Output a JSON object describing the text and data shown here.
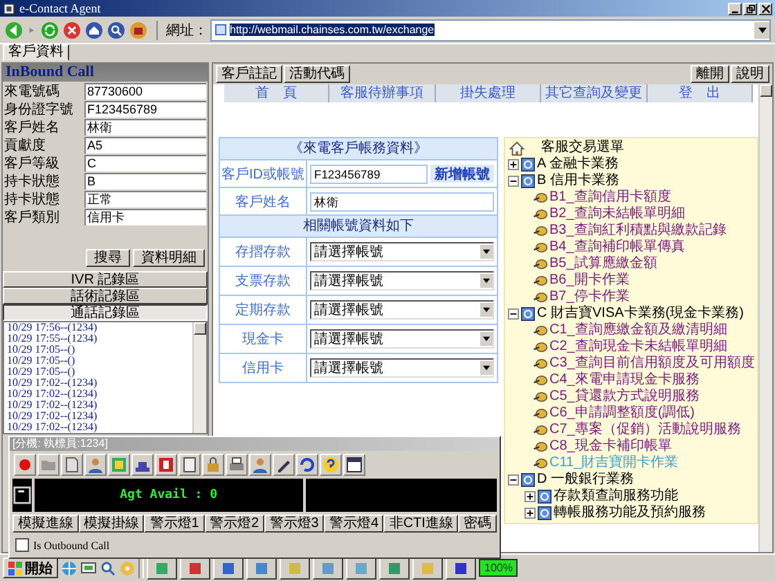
{
  "window": {
    "title": "e-Contact Agent"
  },
  "toolbar": {
    "address_label": "網址：",
    "url": "http://webmail.chainses.com.tw/exchange"
  },
  "main_tabs": [
    {
      "label": "客戶資料",
      "selected": true
    }
  ],
  "inbound": {
    "title": "InBound Call",
    "fields": [
      {
        "label": "來電號碼",
        "value": "87730600"
      },
      {
        "label": "身份證字號",
        "value": "F123456789"
      },
      {
        "label": "客戶姓名",
        "value": "林衛"
      },
      {
        "label": "貢獻度",
        "value": "A5"
      },
      {
        "label": "客戶等級",
        "value": "C"
      },
      {
        "label": "持卡狀態",
        "value": "B"
      },
      {
        "label": "持卡狀態",
        "value": "正常"
      },
      {
        "label": "客戶類別",
        "value": "信用卡"
      }
    ],
    "buttons": [
      "搜尋",
      "資料明細"
    ]
  },
  "record_sections": [
    {
      "label": "IVR 記錄區",
      "selected": false
    },
    {
      "label": "話術記錄區",
      "selected": false
    },
    {
      "label": "通話記錄區",
      "selected": true
    }
  ],
  "call_log": [
    "10/29 17:56--(1234)",
    "10/29 17:55--(1234)",
    "10/29 17:05--()",
    "10/29 17:05--()",
    "10/29 17:05--()",
    "10/29 17:02--(1234)",
    "10/29 17:02--(1234)",
    "10/29 17:02--(1234)",
    "10/29 17:02--(1234)",
    "10/29 17:02--(1234)"
  ],
  "phone_bar": {
    "title": "[分機: 執標員:1234]",
    "display": "Agt Avail : 0",
    "buttons": [
      "模擬進線",
      "模擬掛線",
      "警示燈1",
      "警示燈2",
      "警示燈3",
      "警示燈4",
      "非CTI進線",
      "密碼"
    ],
    "outbound": {
      "label": "Is Outbound Call",
      "checked": false
    }
  },
  "content_tabs": [
    "客戶註記",
    "活動代碼"
  ],
  "window_buttons": [
    "離開",
    "說明"
  ],
  "nav": [
    "首　頁",
    "客服待辦事項",
    "掛失處理",
    "其它查詢及變更",
    "登　出"
  ],
  "account_form": {
    "title": "《來電客戶帳務資料》",
    "id_label": "客戶ID或帳號",
    "id_value": "F123456789",
    "add_button": "新增帳號",
    "name_label": "客戶姓名",
    "name_value": "林衛",
    "subtitle": "相關帳號資料如下",
    "accounts": [
      {
        "label": "存摺存款",
        "value": "請選擇帳號"
      },
      {
        "label": "支票存款",
        "value": "請選擇帳號"
      },
      {
        "label": "定期存款",
        "value": "請選擇帳號"
      },
      {
        "label": "現金卡",
        "value": "請選擇帳號"
      },
      {
        "label": "信用卡",
        "value": "請選擇帳號"
      }
    ]
  },
  "menu_tree": {
    "label": "客服交易選單",
    "children": [
      {
        "label": "A 金融卡業務",
        "expanded": false
      },
      {
        "label": "B 信用卡業務",
        "expanded": true,
        "children": [
          {
            "label": "B1_查詢信用卡額度",
            "selected": false
          },
          {
            "label": "B2_查詢未結帳單明細",
            "selected": false
          },
          {
            "label": "B3_查詢紅利積點與繳款記錄",
            "selected": false
          },
          {
            "label": "B4_查詢補印帳單傳真",
            "selected": false
          },
          {
            "label": "B5_試算應繳金額",
            "selected": false
          },
          {
            "label": "B6_開卡作業",
            "selected": false
          },
          {
            "label": "B7_停卡作業",
            "selected": false
          }
        ]
      },
      {
        "label": "C 財吉寶VISA卡業務(現金卡業務)",
        "expanded": true,
        "children": [
          {
            "label": "C1_查詢應繳金額及繳清明細",
            "selected": false
          },
          {
            "label": "C2_查詢現金卡未結帳單明細",
            "selected": false
          },
          {
            "label": "C3_查詢目前信用額度及可用額度",
            "selected": false
          },
          {
            "label": "C4_來電申請現金卡服務",
            "selected": false
          },
          {
            "label": "C5_貸還款方式說明服務",
            "selected": false
          },
          {
            "label": "C6_申請調整額度(調低)",
            "selected": false
          },
          {
            "label": "C7_專案（促銷）活動說明服務",
            "selected": false
          },
          {
            "label": "C8_現金卡補印帳單",
            "selected": false
          },
          {
            "label": "C11_財吉寶開卡作業",
            "selected": true
          }
        ]
      },
      {
        "label": "D 一般銀行業務",
        "expanded": true,
        "children": [
          {
            "label": "存款類查詢服務功能",
            "expanded": false
          },
          {
            "label": "轉帳服務功能及預約服務",
            "expanded": false
          }
        ]
      }
    ]
  },
  "taskbar": {
    "start": "開始",
    "zoom": "100%"
  }
}
